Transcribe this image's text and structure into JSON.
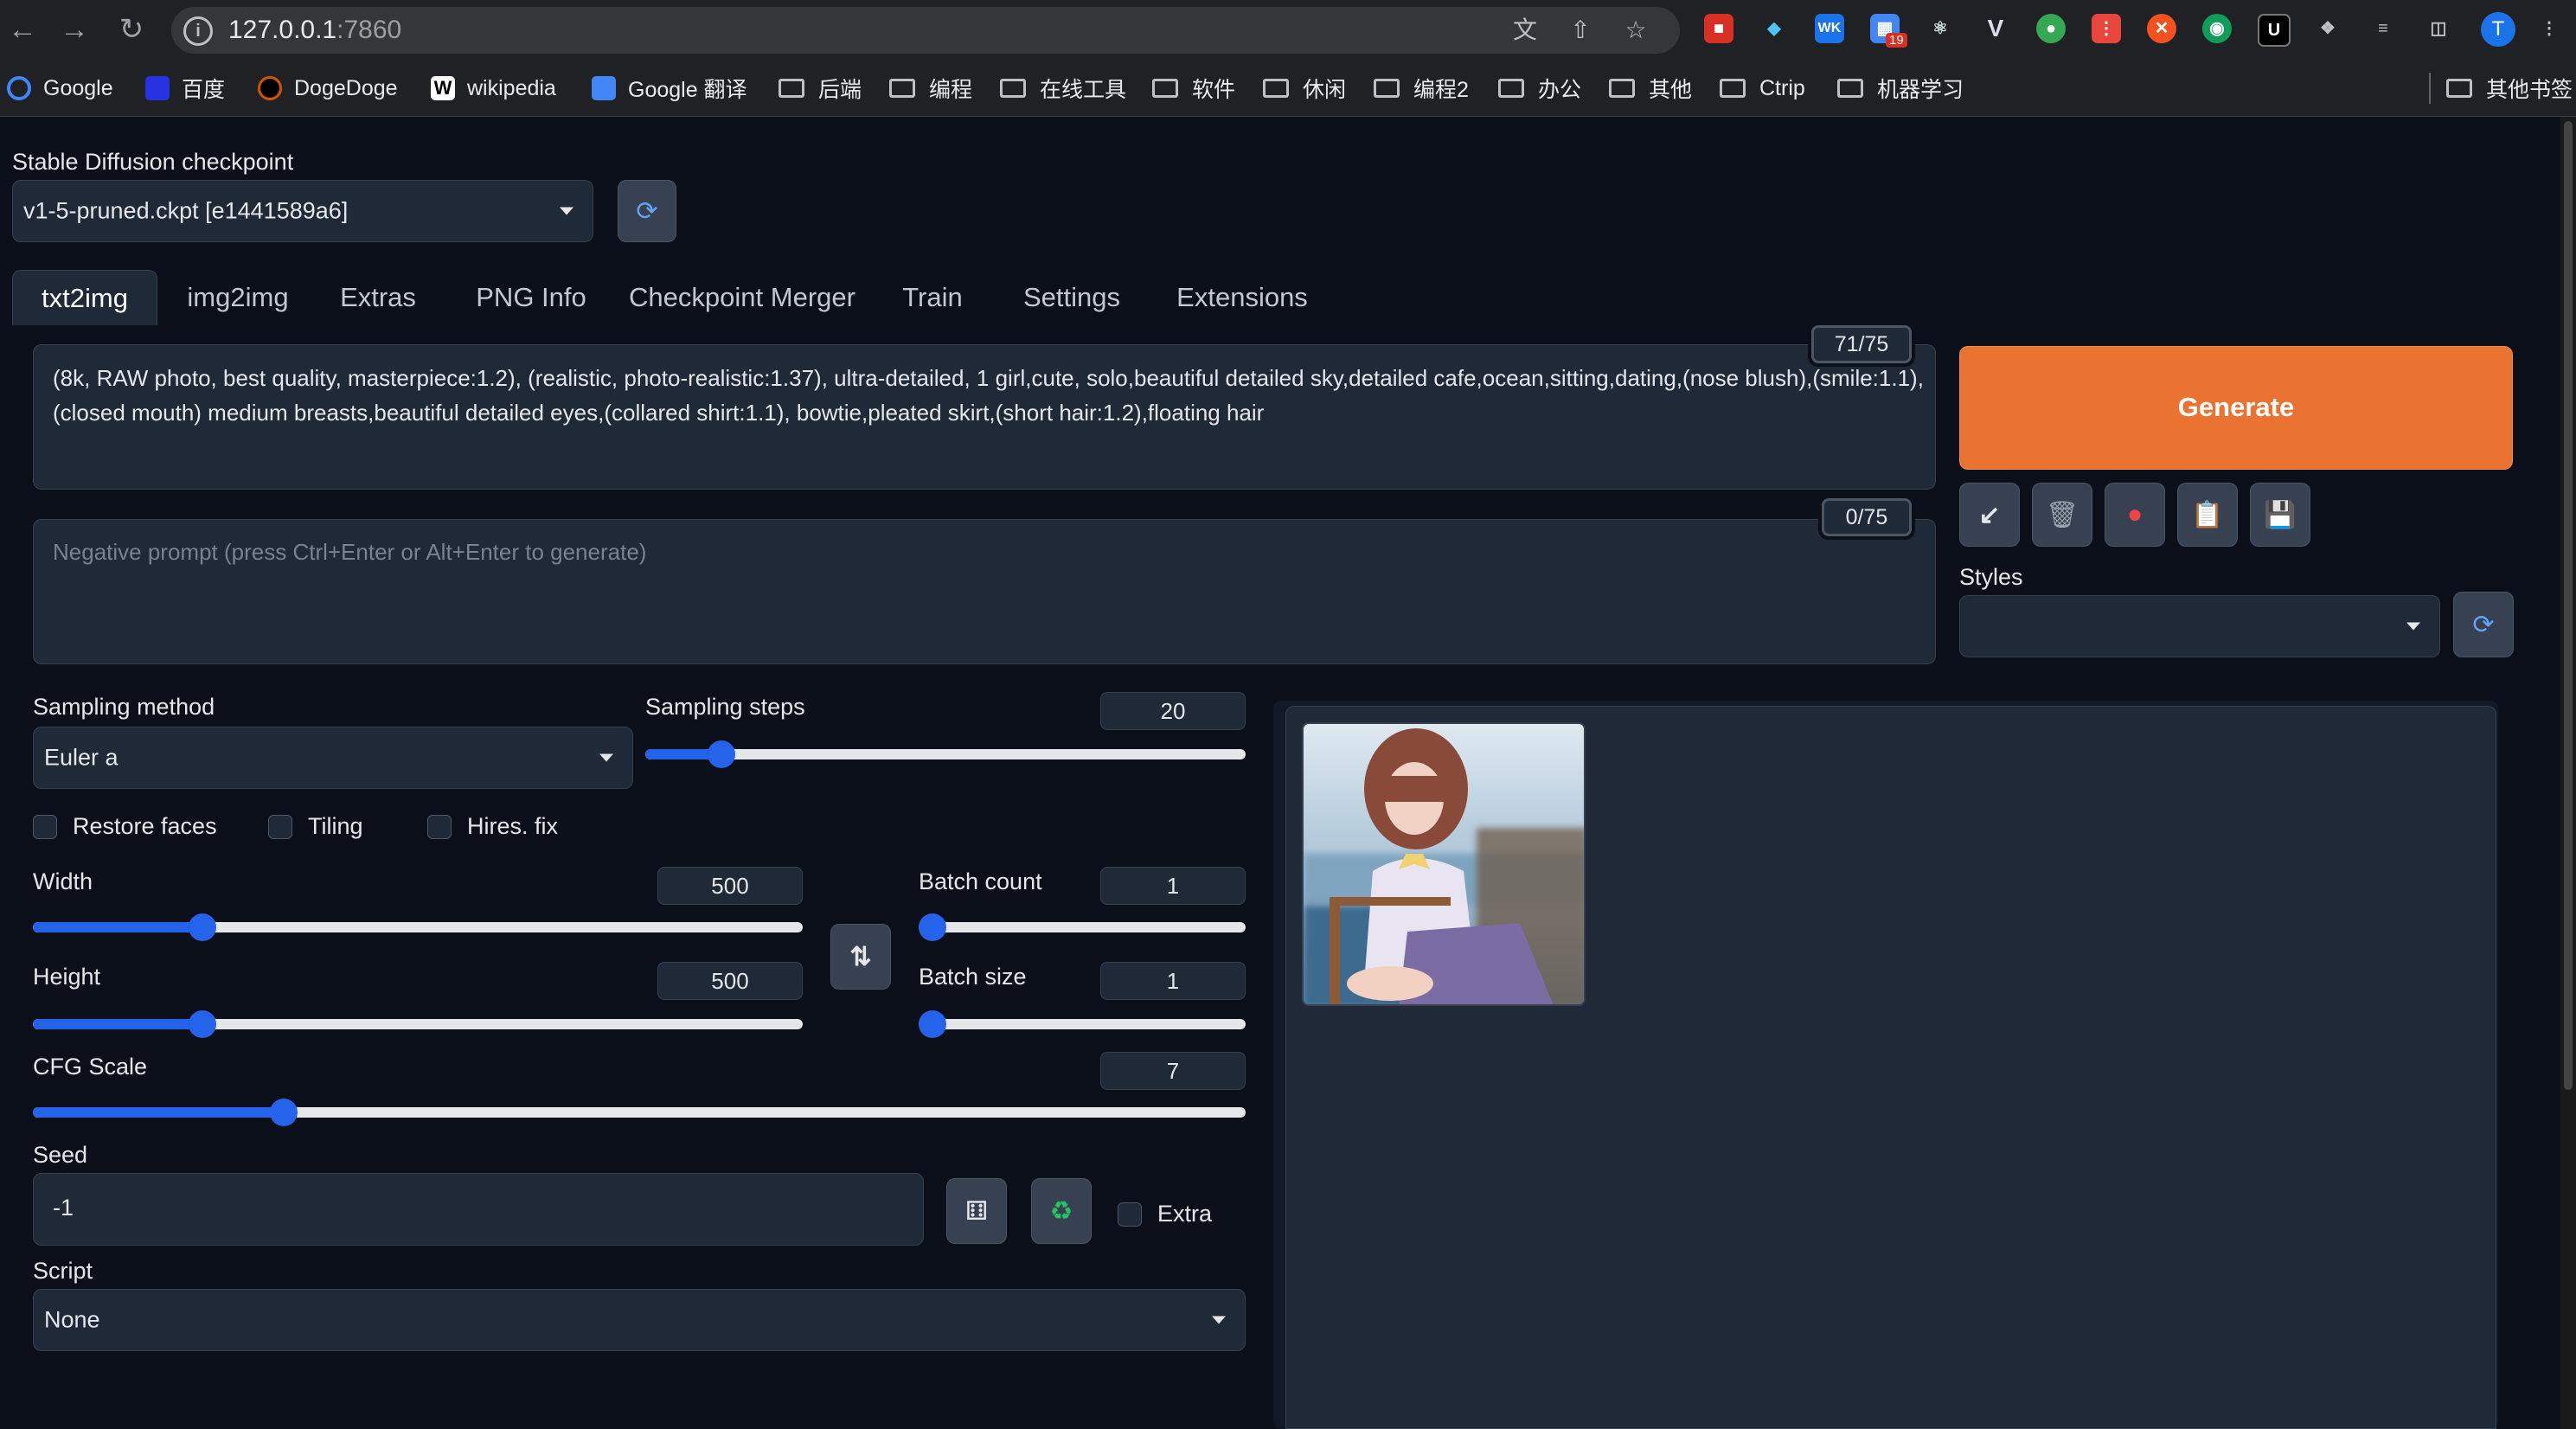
{
  "browser": {
    "url_host": "127.0.0.1",
    "url_port": ":7860",
    "avatar_letter": "T",
    "ext_badge": "19",
    "bookmarks": [
      {
        "label": "Google",
        "icon": "google-icon"
      },
      {
        "label": "百度",
        "icon": "baidu-icon"
      },
      {
        "label": "DogeDoge",
        "icon": "dogedoge-icon"
      },
      {
        "label": "wikipedia",
        "icon": "wikipedia-icon"
      },
      {
        "label": "Google 翻译",
        "icon": "google-translate-icon"
      },
      {
        "label": "后端",
        "icon": "folder-icon"
      },
      {
        "label": "编程",
        "icon": "folder-icon"
      },
      {
        "label": "在线工具",
        "icon": "folder-icon"
      },
      {
        "label": "软件",
        "icon": "folder-icon"
      },
      {
        "label": "休闲",
        "icon": "folder-icon"
      },
      {
        "label": "编程2",
        "icon": "folder-icon"
      },
      {
        "label": "办公",
        "icon": "folder-icon"
      },
      {
        "label": "其他",
        "icon": "folder-icon"
      },
      {
        "label": "Ctrip",
        "icon": "folder-icon"
      },
      {
        "label": "机器学习",
        "icon": "folder-icon"
      }
    ],
    "other_bookmarks": "其他书签"
  },
  "checkpoint": {
    "label": "Stable Diffusion checkpoint",
    "value": "v1-5-pruned.ckpt [e1441589a6]"
  },
  "tabs": [
    "txt2img",
    "img2img",
    "Extras",
    "PNG Info",
    "Checkpoint Merger",
    "Train",
    "Settings",
    "Extensions"
  ],
  "prompt": {
    "text": "(8k, RAW photo, best quality, masterpiece:1.2), (realistic, photo-realistic:1.37), ultra-detailed, 1 girl,cute, solo,beautiful detailed sky,detailed cafe,ocean,sitting,dating,(nose blush),(smile:1.1),(closed mouth) medium breasts,beautiful detailed eyes,(collared shirt:1.1), bowtie,pleated skirt,(short hair:1.2),floating hair",
    "counter": "71/75"
  },
  "negative_prompt": {
    "placeholder": "Negative prompt (press Ctrl+Enter or Alt+Enter to generate)",
    "counter": "0/75"
  },
  "generate_label": "Generate",
  "styles": {
    "label": "Styles",
    "value": ""
  },
  "sampling": {
    "method_label": "Sampling method",
    "method_value": "Euler a",
    "steps_label": "Sampling steps",
    "steps_value": "20",
    "steps_min": 1,
    "steps_max": 150
  },
  "checkboxes": {
    "restore_faces": "Restore faces",
    "tiling": "Tiling",
    "hires_fix": "Hires. fix"
  },
  "width": {
    "label": "Width",
    "value": "500",
    "min": 64,
    "max": 2048
  },
  "height": {
    "label": "Height",
    "value": "500",
    "min": 64,
    "max": 2048
  },
  "batch_count": {
    "label": "Batch count",
    "value": "1",
    "min": 1,
    "max": 100
  },
  "batch_size": {
    "label": "Batch size",
    "value": "1",
    "min": 1,
    "max": 8
  },
  "cfg": {
    "label": "CFG Scale",
    "value": "7",
    "min": 1,
    "max": 30
  },
  "seed": {
    "label": "Seed",
    "value": "-1",
    "extra_label": "Extra"
  },
  "script": {
    "label": "Script",
    "value": "None"
  }
}
